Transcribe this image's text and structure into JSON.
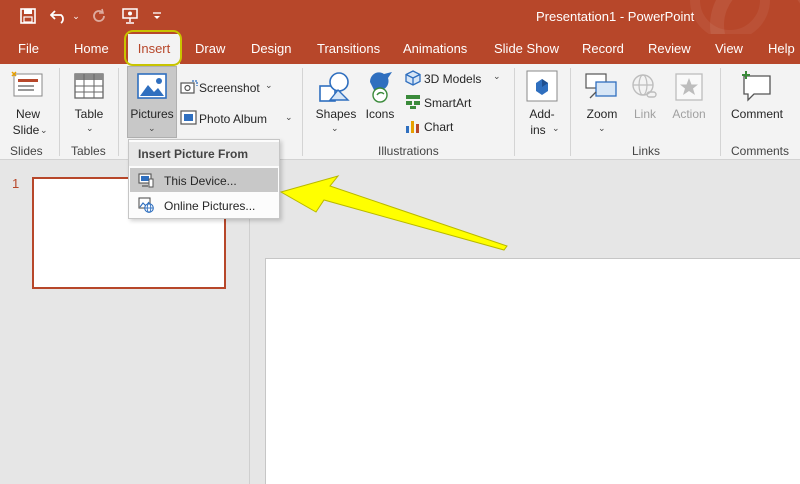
{
  "title_bar": {
    "title": "Presentation1  -  PowerPoint",
    "qat": [
      "save-icon",
      "undo-icon",
      "undo-dropdown-icon",
      "redo-icon",
      "present-icon",
      "customize-icon"
    ]
  },
  "tabs": [
    {
      "label": "File"
    },
    {
      "label": "Home"
    },
    {
      "label": "Insert",
      "active": true
    },
    {
      "label": "Draw"
    },
    {
      "label": "Design"
    },
    {
      "label": "Transitions"
    },
    {
      "label": "Animations"
    },
    {
      "label": "Slide Show"
    },
    {
      "label": "Record"
    },
    {
      "label": "Review"
    },
    {
      "label": "View"
    },
    {
      "label": "Help"
    }
  ],
  "ribbon": {
    "new_slide": {
      "line1": "New",
      "line2": "Slide"
    },
    "table": "Table",
    "pictures": "Pictures",
    "screenshot": "Screenshot",
    "photo_album": "Photo Album",
    "shapes": "Shapes",
    "icons": "Icons",
    "models_3d": "3D Models",
    "smartart": "SmartArt",
    "chart": "Chart",
    "addins": {
      "line1": "Add-",
      "line2": "ins"
    },
    "zoom": "Zoom",
    "link": "Link",
    "action": "Action",
    "comment": "Comment",
    "groups": {
      "slides": "Slides",
      "tables": "Tables",
      "illustrations": "Illustrations",
      "links": "Links",
      "comments": "Comments"
    }
  },
  "dropdown": {
    "header": "Insert Picture From",
    "items": [
      {
        "label": "This Device...",
        "highlighted": true
      },
      {
        "label": "Online Pictures...",
        "highlighted": false
      }
    ]
  },
  "slides_panel": {
    "slide_number": "1"
  },
  "colors": {
    "accent": "#b7472a",
    "highlight_ring": "#c8c400",
    "arrow": "#ffff00"
  }
}
